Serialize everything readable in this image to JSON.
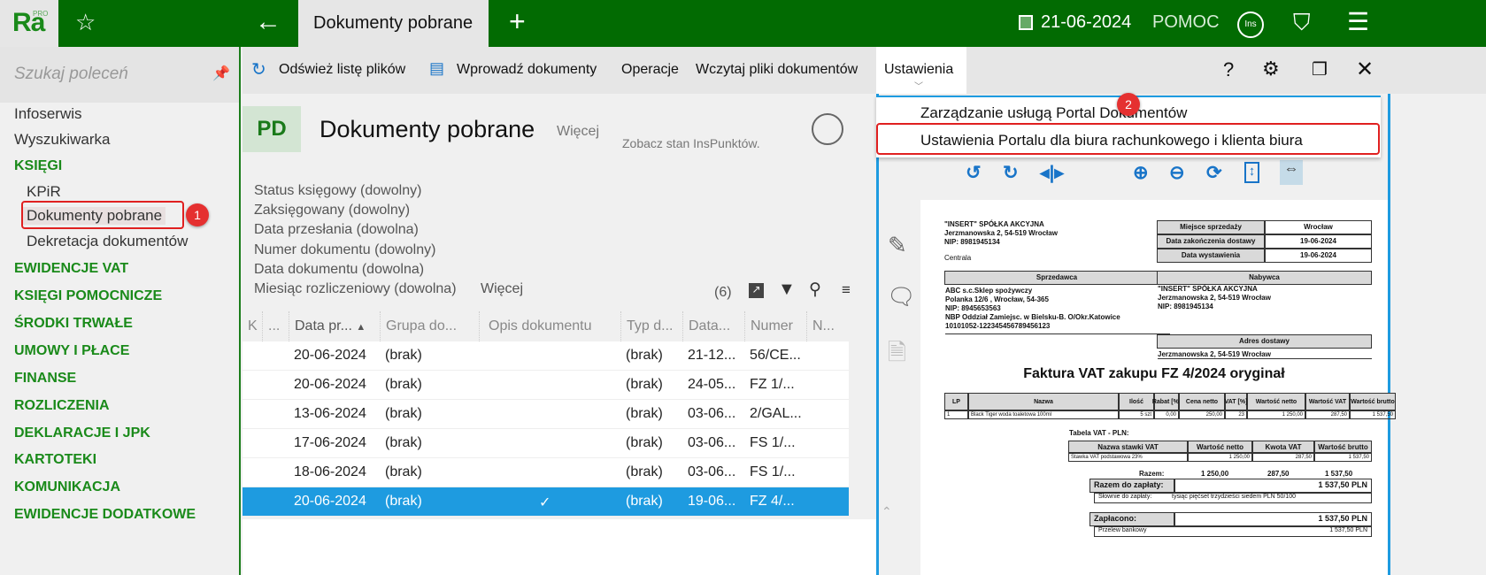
{
  "topbar": {
    "logo": "Ra",
    "logo_sup": "PRO",
    "tab": "Dokumenty pobrane",
    "date": "21-06-2024",
    "help": "POMOC",
    "ins": "Ins"
  },
  "sidebar": {
    "search_placeholder": "Szukaj poleceń",
    "items": [
      "Infoserwis",
      "Wyszukiwarka"
    ],
    "ksiegi": "KSIĘGI",
    "sub": [
      "KPiR",
      "Dokumenty pobrane",
      "Dekretacja dokumentów"
    ],
    "sections": [
      "EWIDENCJE VAT",
      "KSIĘGI POMOCNICZE",
      "ŚRODKI TRWAŁE",
      "UMOWY I PŁACE",
      "FINANSE",
      "ROZLICZENIA",
      "DEKLARACJE I JPK",
      "KARTOTEKI",
      "KOMUNIKACJA",
      "EWIDENCJE DODATKOWE"
    ]
  },
  "toolbar": {
    "refresh": "Odśwież listę plików",
    "enter": "Wprowadź dokumenty",
    "ops": "Operacje",
    "load": "Wczytaj pliki dokumentów",
    "settings": "Ustawienia"
  },
  "header": {
    "badge": "PD",
    "title": "Dokumenty pobrane",
    "more": "Więcej",
    "inspunkty": "Zobacz stan InsPunktów."
  },
  "filters": [
    "Status księgowy (dowolny)",
    "Zaksięgowany (dowolny)",
    "Data przesłania (dowolna)",
    "Numer dokumentu (dowolny)",
    "Data dokumentu (dowolna)",
    "Miesiąc rozliczeniowy (dowolna)"
  ],
  "filters_more": "Więcej",
  "count": "(6)",
  "grid": {
    "columns": [
      "K",
      "...",
      "Data pr...",
      "Grupa do...",
      "Opis dokumentu",
      "Typ d...",
      "Data...",
      "Numer",
      "N..."
    ],
    "rows": [
      [
        "20-06-2024",
        "(brak)",
        "",
        "(brak)",
        "21-12...",
        "56/CE..."
      ],
      [
        "20-06-2024",
        "(brak)",
        "",
        "(brak)",
        "24-05...",
        "FZ 1/..."
      ],
      [
        "13-06-2024",
        "(brak)",
        "",
        "(brak)",
        "03-06...",
        "2/GAL..."
      ],
      [
        "17-06-2024",
        "(brak)",
        "",
        "(brak)",
        "03-06...",
        "FS 1/..."
      ],
      [
        "18-06-2024",
        "(brak)",
        "",
        "(brak)",
        "03-06...",
        "FS 1/..."
      ],
      [
        "20-06-2024",
        "(brak)",
        "✓",
        "(brak)",
        "19-06...",
        "FZ 4/..."
      ]
    ]
  },
  "menu": [
    "Zarządzanie usługą Portal Dokumentów",
    "Ustawienia Portalu dla biura rachunkowego i klienta biura"
  ],
  "badges": [
    "1",
    "2"
  ],
  "invoice": {
    "seller_head": [
      "\"INSERT\" SPÓŁKA AKCYJNA",
      "Jerzmanowska 2, 54-519 Wrocław",
      "NIP: 8981945134",
      "Centrala"
    ],
    "meta": [
      [
        "Miejsce sprzedaży",
        "Wrocław"
      ],
      [
        "Data zakończenia dostawy",
        "19-06-2024"
      ],
      [
        "Data wystawienia",
        "19-06-2024"
      ]
    ],
    "sprzedawca_label": "Sprzedawca",
    "sprzedawca": [
      "ABC s.c.Sklep spożywczy",
      "Polanka  12/6 , Wrocław, 54-365",
      "NIP: 8945653563",
      "NBP Oddział Zamiejsc. w Bielsku-B.  O/Okr.Katowice",
      "10101052-122345456789456123"
    ],
    "nabywca_label": "Nabywca",
    "nabywca": [
      "\"INSERT\" SPÓŁKA AKCYJNA",
      "Jerzmanowska 2, 54-519 Wrocław",
      "NIP: 8981945134"
    ],
    "adres_label": "Adres dostawy",
    "adres": "Jerzmanowska 2, 54-519 Wrocław",
    "title": "Faktura VAT zakupu FZ 4/2024 oryginał",
    "items_head": [
      "LP",
      "Nazwa",
      "Ilość",
      "Rabat [%]",
      "Cena netto",
      "VAT [%]",
      "Wartość netto",
      "Wartość VAT",
      "Wartość brutto"
    ],
    "items": [
      [
        "1",
        "Black Tiger woda toaletowa 100ml",
        "5 szt",
        "0,00",
        "250,00",
        "23",
        "1 250,00",
        "287,50",
        "1 537,50"
      ]
    ],
    "vat_label": "Tabela VAT - PLN:",
    "vat_head": [
      "Nazwa stawki VAT",
      "Wartość netto",
      "Kwota VAT",
      "Wartość brutto"
    ],
    "vat_row": [
      "Stawka VAT podstawowa 23%",
      "1 250,00",
      "287,50",
      "1 537,50"
    ],
    "vat_sum": [
      "Razem:",
      "1 250,00",
      "287,50",
      "1 537,50"
    ],
    "topay_label": "Razem do zapłaty:",
    "topay": "1 537,50 PLN",
    "words_label": "Słownie do zapłaty:",
    "words": "tysiąc pięćset trzydzieści siedem PLN 50/100",
    "paid_label": "Zapłacono:",
    "paid": "1 537,50 PLN",
    "transfer_label": "Przelew bankowy",
    "transfer": "1 537,50 PLN"
  }
}
